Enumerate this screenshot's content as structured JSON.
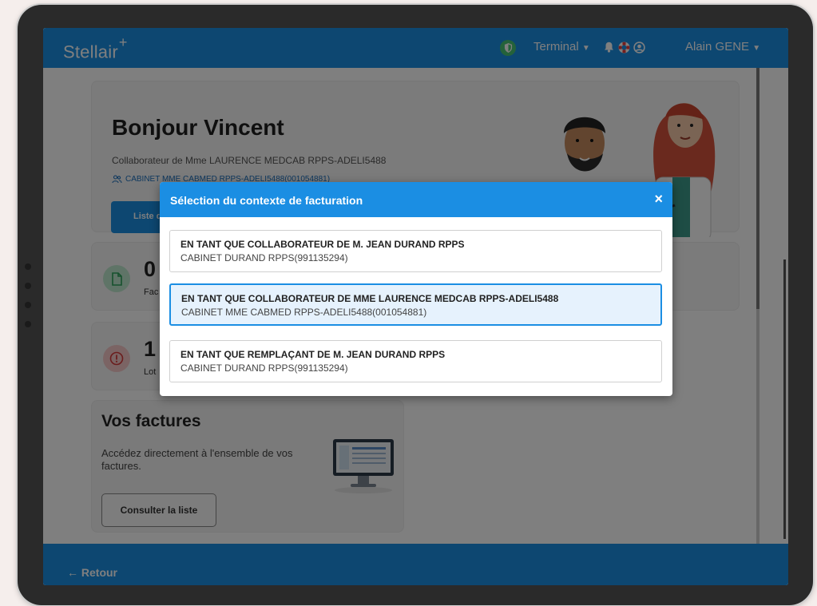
{
  "app": {
    "logo": "Stellair",
    "logo_mark": "+"
  },
  "topbar": {
    "terminal_label": "Terminal",
    "user_name": "Alain GENE"
  },
  "home": {
    "greeting": "Bonjour Vincent",
    "subtitle": "Collaborateur de Mme LAURENCE MEDCAB RPPS-ADELI5488",
    "cabinet": "CABINET MME CABMED RPPS-ADELI5488(001054881)",
    "list_button": "Liste d"
  },
  "stats": [
    {
      "value": "0",
      "label": "Fac"
    },
    {
      "value": "1",
      "label": "Lot"
    }
  ],
  "factures": {
    "title": "Vos factures",
    "description": "Accédez directement à l'ensemble de vos factures.",
    "button": "Consulter la liste"
  },
  "footer": {
    "back_label": "← Retour"
  },
  "modal": {
    "title": "Sélection du contexte de facturation",
    "close": "×",
    "options": [
      {
        "title": "EN TANT QUE COLLABORATEUR DE M. JEAN DURAND RPPS",
        "cabinet": "CABINET DURAND RPPS(991135294)",
        "selected": false
      },
      {
        "title": "EN TANT QUE COLLABORATEUR DE MME LAURENCE MEDCAB RPPS-ADELI5488",
        "cabinet": "CABINET MME CABMED RPPS-ADELI5488(001054881)",
        "selected": true
      },
      {
        "title": "EN TANT QUE REMPLAÇANT DE M. JEAN DURAND RPPS",
        "cabinet": "CABINET DURAND RPPS(991135294)",
        "selected": false
      }
    ]
  },
  "colors": {
    "brand_blue": "#1b8ee3",
    "shield_green": "#49c474",
    "selected_bg": "#e6f2fd"
  }
}
